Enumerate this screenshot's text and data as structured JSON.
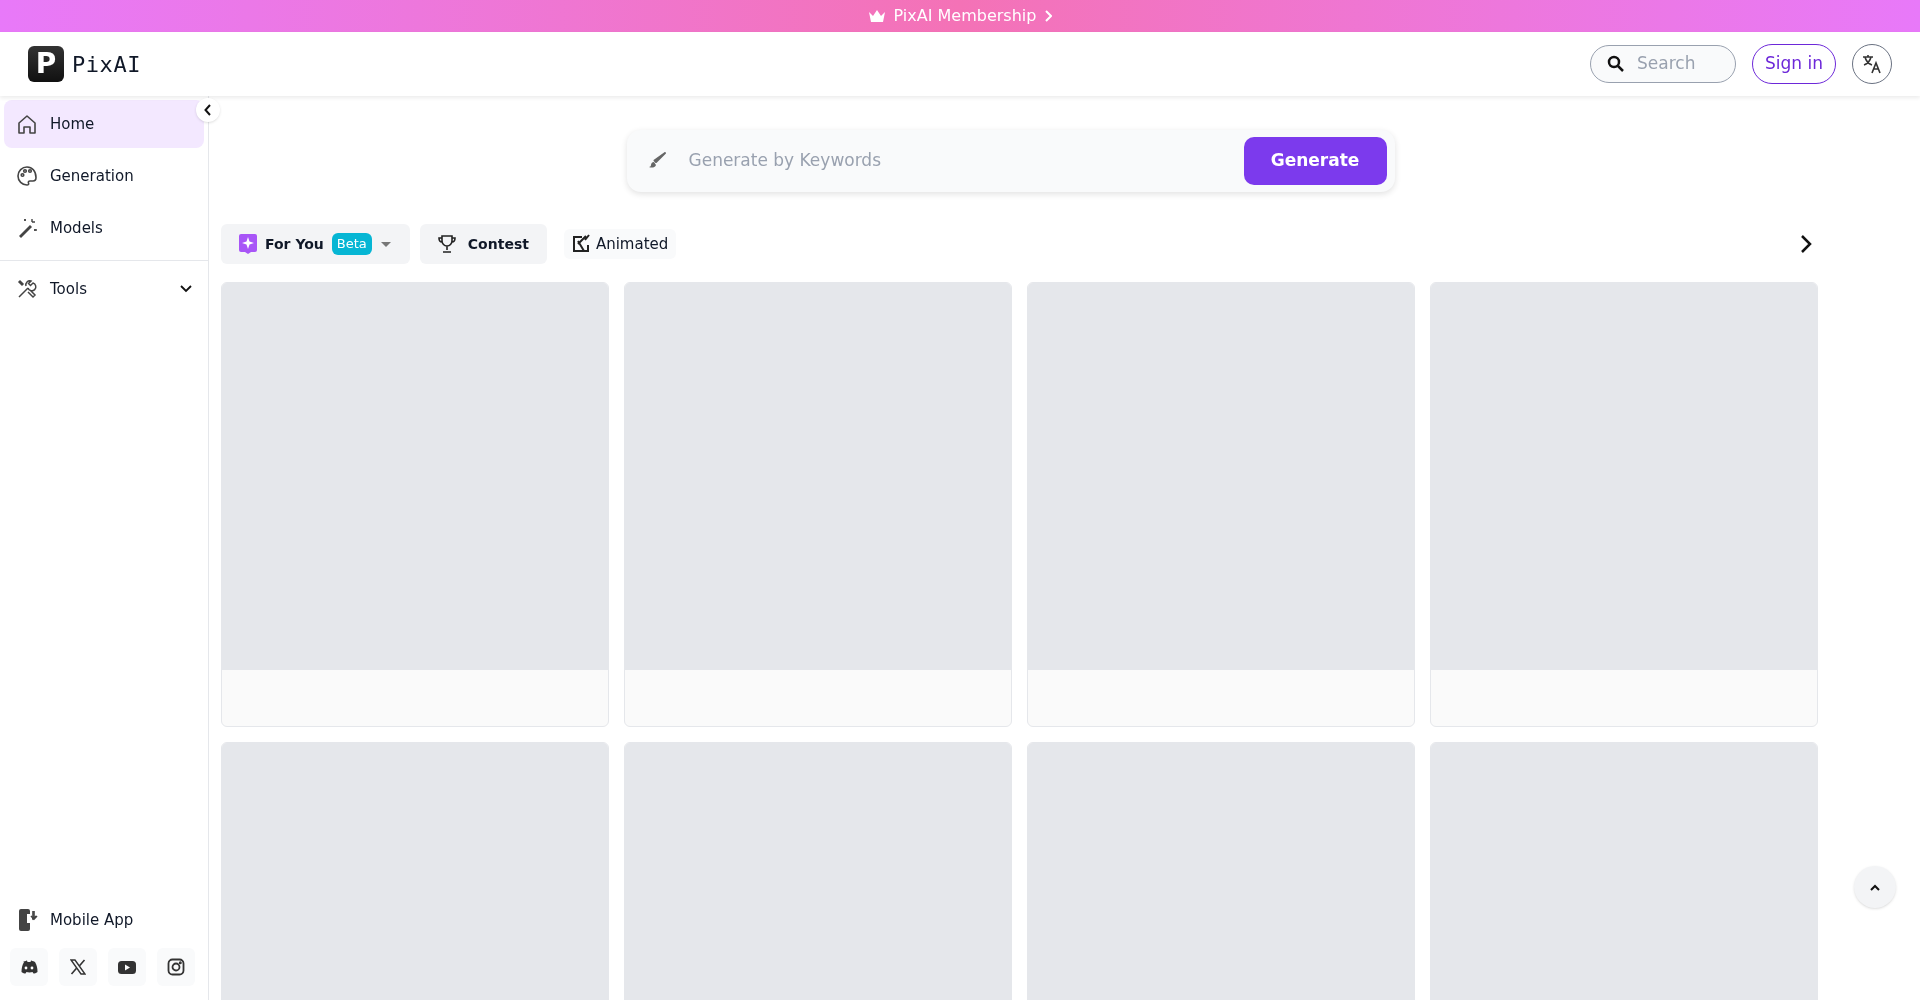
{
  "banner": {
    "label": "PixAI Membership"
  },
  "header": {
    "logo_letter": "P",
    "logo_text": "PixAI",
    "search": {
      "placeholder": "Search"
    },
    "sign_in": "Sign in"
  },
  "sidebar": {
    "items": [
      {
        "kind": "home",
        "label": "Home",
        "selected": true
      },
      {
        "kind": "generation",
        "label": "Generation",
        "selected": false
      },
      {
        "kind": "models",
        "label": "Models",
        "selected": false
      }
    ],
    "tools": {
      "label": "Tools",
      "expanded": false
    },
    "mobile_app": "Mobile App"
  },
  "generate_bar": {
    "placeholder": "Generate by Keywords",
    "button": "Generate"
  },
  "filters": [
    {
      "kind": "foryou",
      "label": "For You",
      "badge": "Beta"
    },
    {
      "kind": "contest",
      "label": "Contest"
    },
    {
      "kind": "animated",
      "label": "Animated"
    }
  ],
  "cards": [
    {
      "kind": "skeleton"
    },
    {
      "kind": "skeleton"
    },
    {
      "kind": "skeleton"
    },
    {
      "kind": "skeleton"
    },
    {
      "kind": "skeleton"
    },
    {
      "kind": "skeleton"
    },
    {
      "kind": "skeleton"
    },
    {
      "kind": "skeleton"
    }
  ]
}
